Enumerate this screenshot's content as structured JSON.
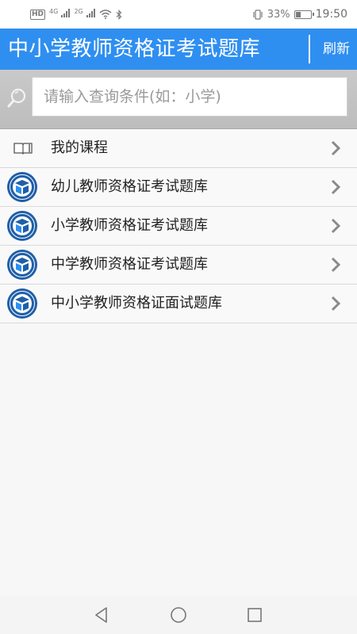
{
  "status_bar": {
    "hd": "HD",
    "net1": "4G",
    "net2": "2G",
    "battery": "33%",
    "time": "19:50"
  },
  "header": {
    "title": "中小学教师资格证考试题库",
    "refresh_label": "刷新"
  },
  "search": {
    "placeholder": "请输入查询条件(如：小学)"
  },
  "list": {
    "items": [
      {
        "label": "我的课程",
        "icon": "book-icon"
      },
      {
        "label": "幼儿教师资格证考试题库",
        "icon": "teacher-emblem-icon"
      },
      {
        "label": "小学教师资格证考试题库",
        "icon": "teacher-emblem-icon"
      },
      {
        "label": "中学教师资格证考试题库",
        "icon": "teacher-emblem-icon"
      },
      {
        "label": "中小学教师资格证面试题库",
        "icon": "teacher-emblem-icon"
      }
    ]
  },
  "colors": {
    "accent": "#2f8ff0",
    "emblem_blue": "#1f5fa8"
  },
  "nav": {
    "back": "back-icon",
    "home": "home-icon",
    "recents": "recents-icon"
  }
}
